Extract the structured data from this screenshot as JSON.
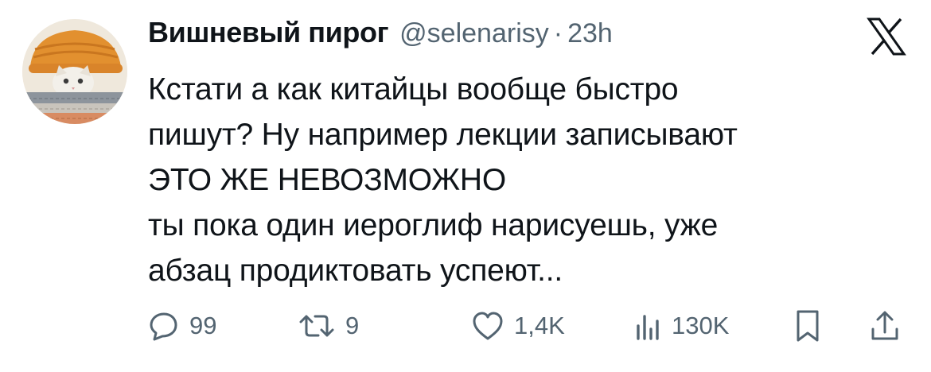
{
  "author": {
    "name": "Вишневый пирог",
    "handle": "@selenarisy",
    "separator": "·",
    "time": "23h"
  },
  "icons": {
    "brand": "x-logo",
    "reply": "reply-icon",
    "retweet": "retweet-icon",
    "like": "heart-icon",
    "views": "views-icon",
    "bookmark": "bookmark-icon",
    "share": "share-icon"
  },
  "tweet": {
    "lines": [
      "Кстати а как китайцы вообще быстро",
      "пишут? Ну например лекции записывают",
      "ЭТО ЖЕ НЕВОЗМОЖНО",
      "ты пока один иероглиф нарисуешь, уже",
      "абзац продиктовать успеют..."
    ]
  },
  "stats": {
    "replies": "99",
    "retweets": "9",
    "likes": "1,4K",
    "views": "130K"
  },
  "colors": {
    "text": "#0f1419",
    "secondary": "#536471",
    "background": "#ffffff"
  }
}
